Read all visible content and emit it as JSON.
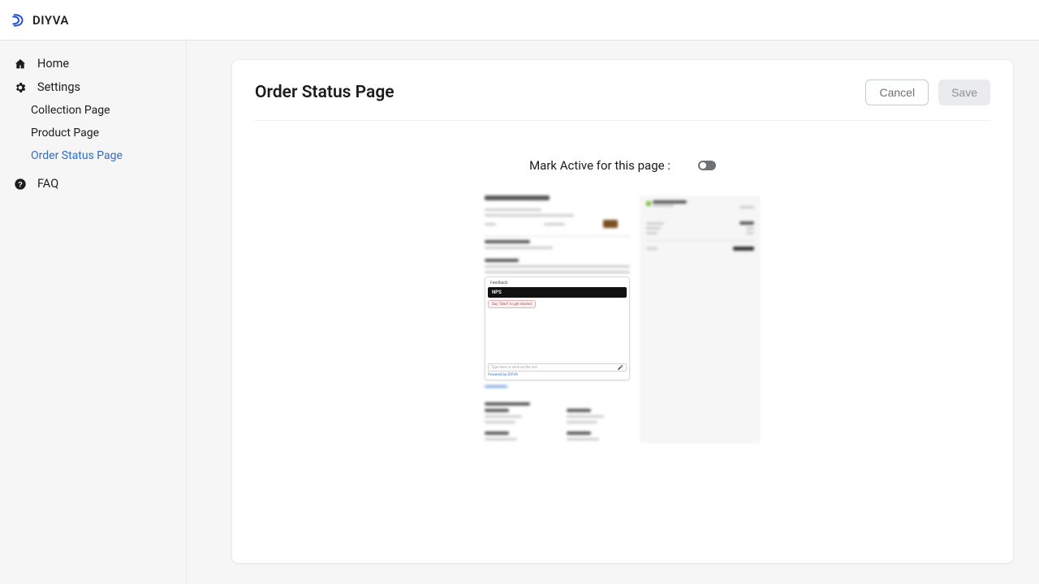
{
  "brand": {
    "name": "DIYVA"
  },
  "sidebar": {
    "home": "Home",
    "settings": "Settings",
    "subitems": [
      "Collection Page",
      "Product Page",
      "Order Status Page"
    ],
    "faq": "FAQ"
  },
  "page": {
    "title": "Order Status Page",
    "cancel": "Cancel",
    "save": "Save",
    "toggle_label": "Mark Active for this page :",
    "toggle_on": false
  },
  "preview": {
    "feedback_label": "Feedback",
    "nps": "NPS",
    "chip": "Say \"Start\" to get started",
    "input_placeholder": "Type here or click on the mic",
    "powered": "Powered by DIYVA"
  }
}
